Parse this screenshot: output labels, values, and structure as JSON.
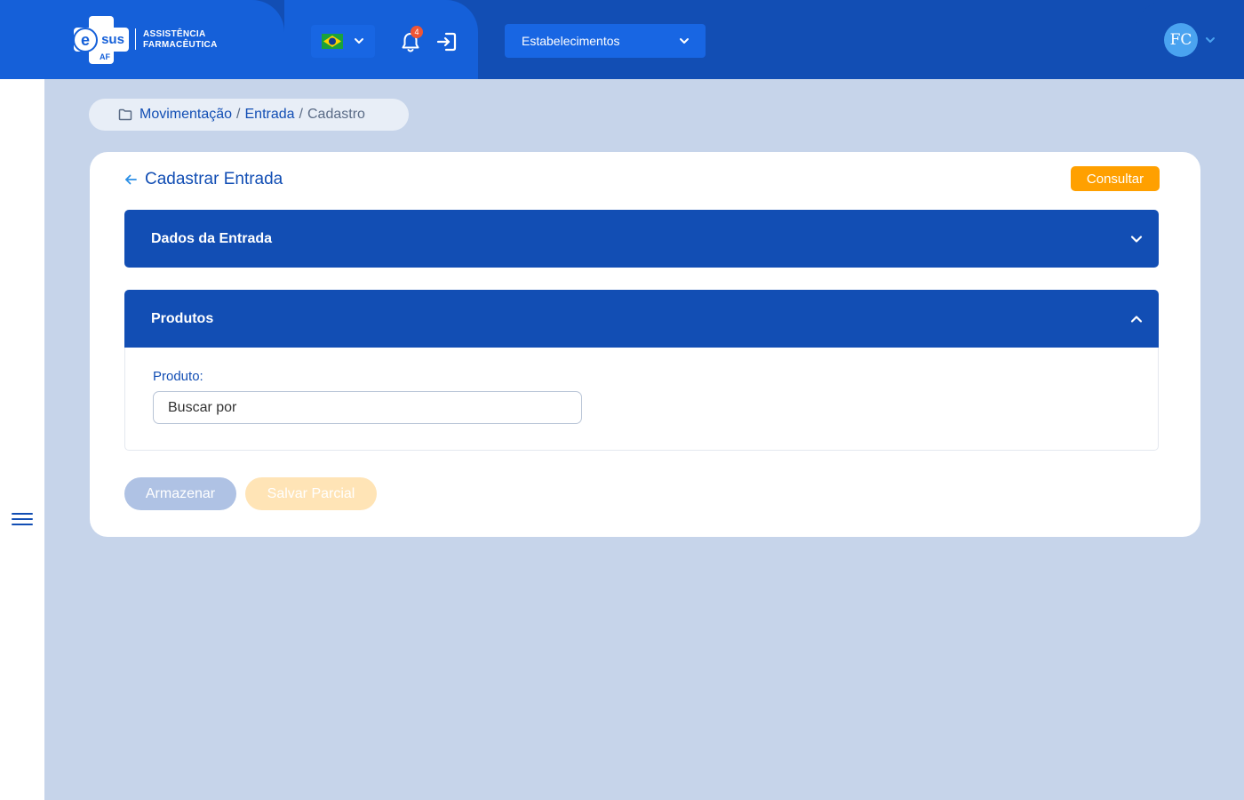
{
  "header": {
    "logo": {
      "mark_text": "sus",
      "mark_letter": "e",
      "sub_text": "AF",
      "tagline_line1": "ASSISTÊNCIA",
      "tagline_line2": "FARMACÊUTICA"
    },
    "language_selector": {
      "selected": "Brasil",
      "icon": "brazil-flag-icon"
    },
    "notifications": {
      "count": "4",
      "icon": "bell-icon"
    },
    "logout": {
      "icon": "exit-icon"
    },
    "establishment_select": {
      "label": "Estabelecimentos"
    },
    "user": {
      "initials": "FC"
    }
  },
  "sidebar": {
    "menu_icon": "hamburger-menu-icon"
  },
  "breadcrumb": {
    "items": [
      "Movimentação",
      "Entrada",
      "Cadastro"
    ],
    "separator": "/"
  },
  "page": {
    "title": "Cadastrar Entrada",
    "consult_button": "Consultar",
    "panels": {
      "dados": {
        "title": "Dados da Entrada",
        "expanded": false
      },
      "produtos": {
        "title": "Produtos",
        "expanded": true,
        "product_label": "Produto:",
        "product_placeholder": "Buscar por"
      }
    },
    "actions": {
      "store_label": "Armazenar",
      "partial_save_label": "Salvar Parcial"
    }
  },
  "colors": {
    "primary": "#124eb4",
    "primary_light": "#1560d9",
    "background": "#c6d4ea",
    "accent": "#ffa000",
    "badge": "#f05535"
  }
}
